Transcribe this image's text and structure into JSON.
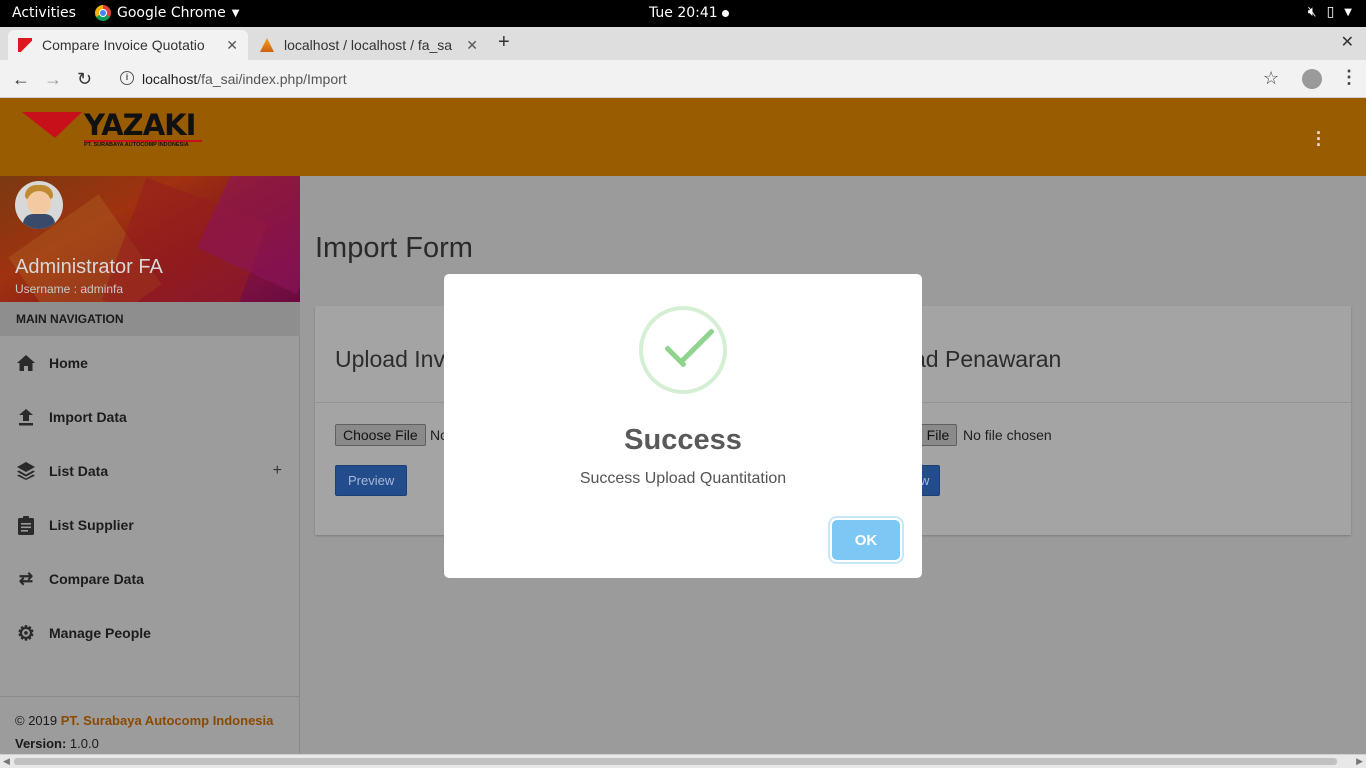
{
  "system_bar": {
    "activities": "Activities",
    "app_name": "Google Chrome",
    "clock": "Tue 20:41"
  },
  "browser": {
    "tabs": [
      {
        "title": "Compare Invoice Quotatio",
        "favicon": "yazaki-favicon",
        "active": true
      },
      {
        "title": "localhost / localhost / fa_sa",
        "favicon": "phpmyadmin-favicon",
        "active": false
      }
    ],
    "url_host": "localhost",
    "url_path": "/fa_sai/index.php/Import"
  },
  "header": {
    "brand": "YAZAKI",
    "brand_sub": "PT. SURABAYA AUTOCOMP INDONESIA",
    "color": "#9a5c00"
  },
  "user": {
    "name": "Administrator FA",
    "username_label": "Username : adminfa"
  },
  "sidebar": {
    "section_header": "MAIN NAVIGATION",
    "items": [
      {
        "label": "Home",
        "icon": "home-icon"
      },
      {
        "label": "Import Data",
        "icon": "upload-icon"
      },
      {
        "label": "List Data",
        "icon": "layers-icon",
        "expand": "+"
      },
      {
        "label": "List Supplier",
        "icon": "clipboard-icon"
      },
      {
        "label": "Compare Data",
        "icon": "swap-arrows-icon"
      },
      {
        "label": "Manage People",
        "icon": "gear-icon"
      }
    ],
    "footer": {
      "copyright": "© 2019",
      "company": "PT. Surabaya Autocomp Indonesia",
      "version_label": "Version:",
      "version": "1.0.0"
    }
  },
  "main": {
    "title": "Import Form",
    "upload_left": {
      "title": "Upload Inv",
      "choose_file": "Choose File",
      "file_status": "No",
      "preview": "Preview"
    },
    "upload_right": {
      "title": "ad Penawaran",
      "choose_file": "e File",
      "file_status": "No file chosen",
      "preview": "w"
    }
  },
  "modal": {
    "title": "Success",
    "message": "Success Upload Quantitation",
    "ok": "OK",
    "accent": "#7cc7f3"
  }
}
